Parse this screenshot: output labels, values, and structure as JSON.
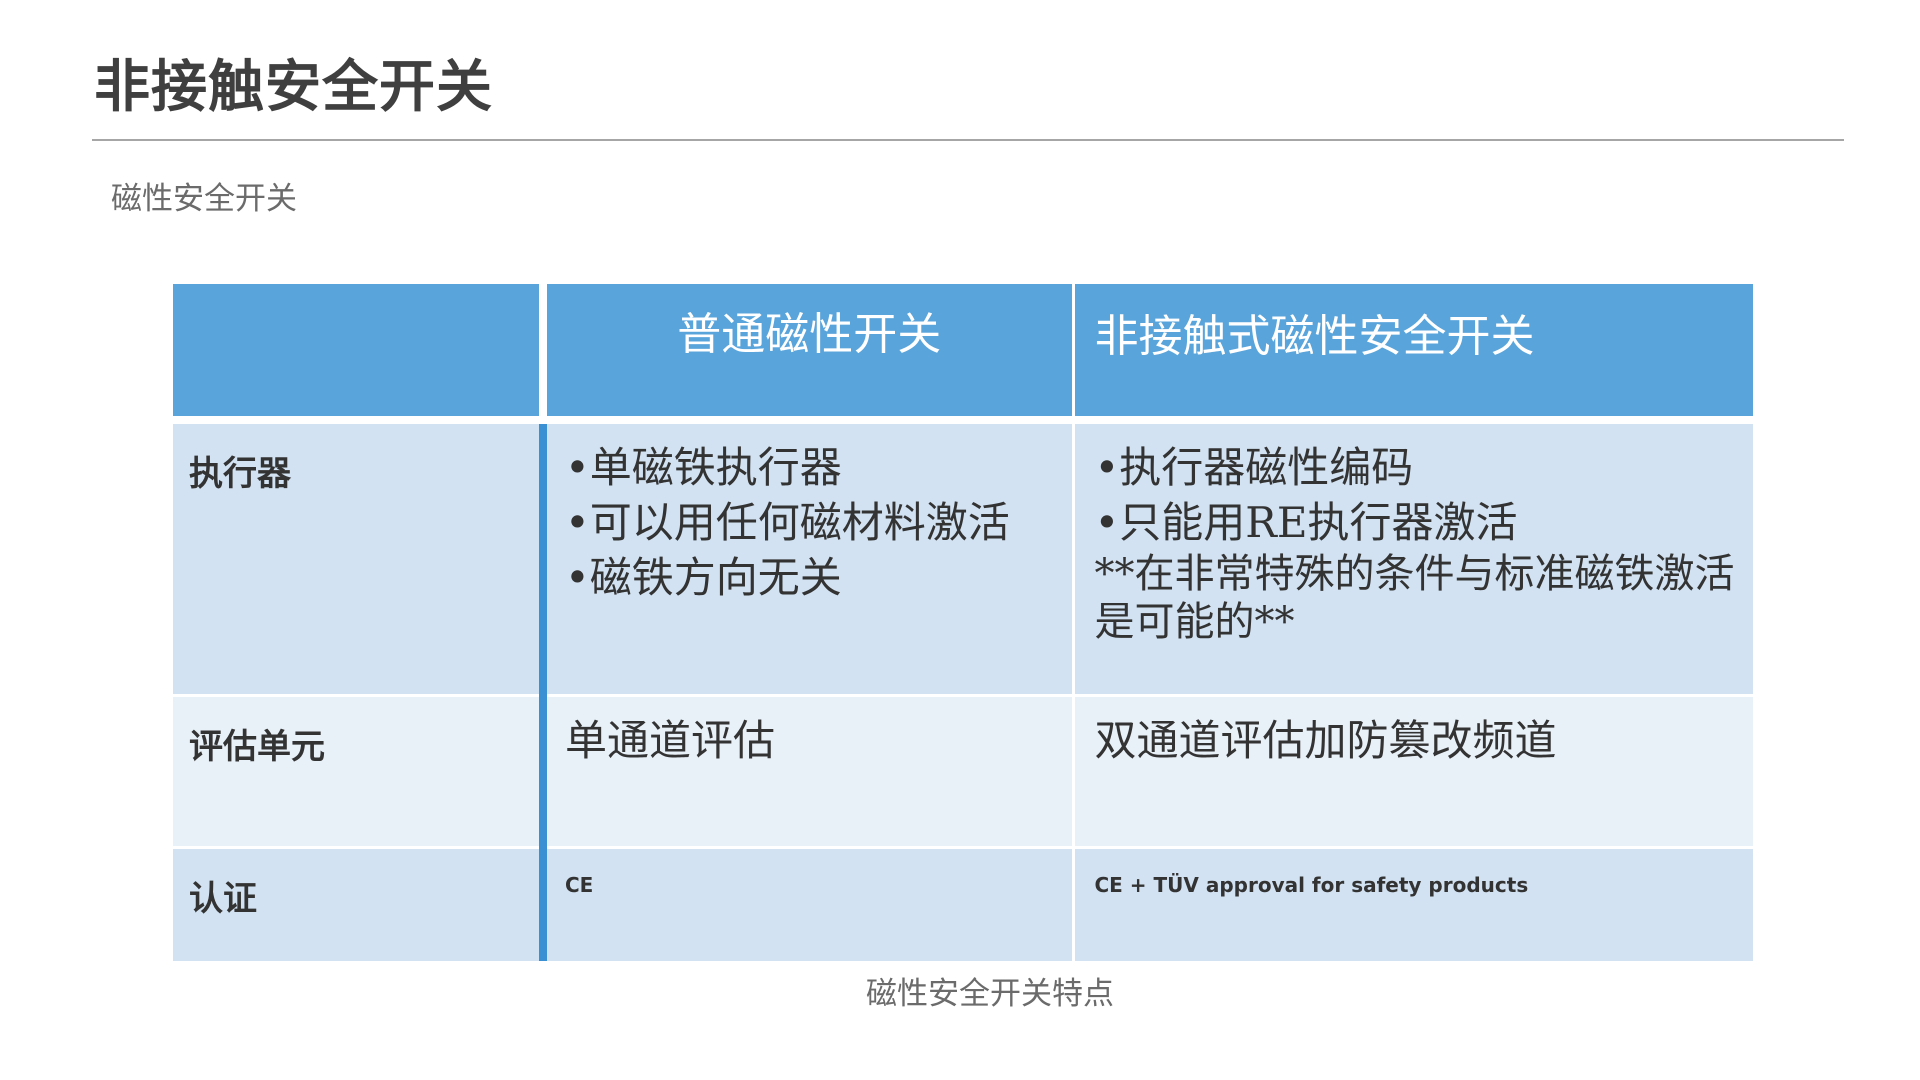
{
  "page": {
    "title": "非接触安全开关",
    "subtitle": "磁性安全开关",
    "caption": "磁性安全开关特点"
  },
  "table": {
    "headers": [
      "",
      "普通磁性开关",
      "非接触式磁性安全开关"
    ],
    "rows": [
      {
        "label": "执行器",
        "col1": [
          "•单磁铁执行器",
          "•可以用任何磁材料激活",
          "•磁铁方向无关"
        ],
        "col2": [
          "•执行器磁性编码",
          "•只能用RE执行器激活"
        ],
        "col2_note": "**在非常特殊的条件与标准磁铁激活是可能的**"
      },
      {
        "label": "评估单元",
        "col1": "单通道评估",
        "col2": "双通道评估加防篡改频道"
      },
      {
        "label": "认证",
        "col1": "CE",
        "col2": "CE + TÜV approval for safety products"
      }
    ]
  },
  "colors": {
    "header_blue": "#59a4db",
    "row_light": "#d2e2f2",
    "row_lighter": "#e8f0f8",
    "divider_blue": "#3b8fd3"
  }
}
